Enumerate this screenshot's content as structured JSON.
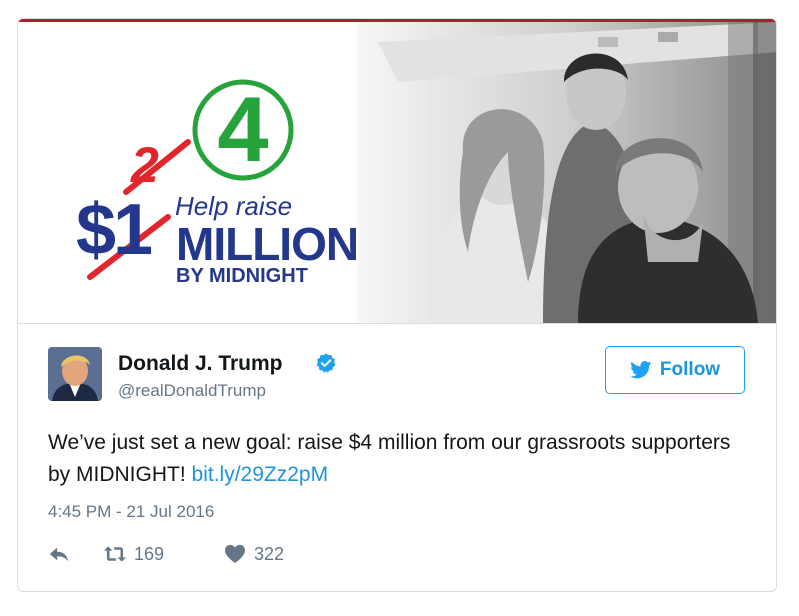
{
  "banner": {
    "strike_number": "2",
    "new_number": "4",
    "dollar_amount": "$1",
    "help_text": "Help raise",
    "million_text": "MILLION",
    "deadline_text": "BY MIDNIGHT",
    "colors": {
      "red": "#e0262b",
      "green": "#26a33b",
      "navy": "#23388d",
      "top_bar": "#a7232d"
    }
  },
  "author": {
    "display_name": "Donald J. Trump",
    "handle": "@realDonaldTrump",
    "verified_icon": "verified-badge-icon"
  },
  "follow_button": {
    "label": "Follow",
    "icon": "twitter-bird-icon"
  },
  "tweet": {
    "text": "We’ve just set a new goal: raise $4 million from our grassroots supporters by MIDNIGHT!",
    "link": "bit.ly/29Zz2pM",
    "timestamp": "4:45 PM - 21 Jul 2016"
  },
  "actions": {
    "reply_icon": "reply-icon",
    "retweet_icon": "retweet-icon",
    "retweet_count": "169",
    "like_icon": "heart-icon",
    "like_count": "322"
  },
  "colors": {
    "accent": "#1da1f2",
    "link": "#1b95e0",
    "muted": "#657786",
    "text": "#14171a"
  }
}
